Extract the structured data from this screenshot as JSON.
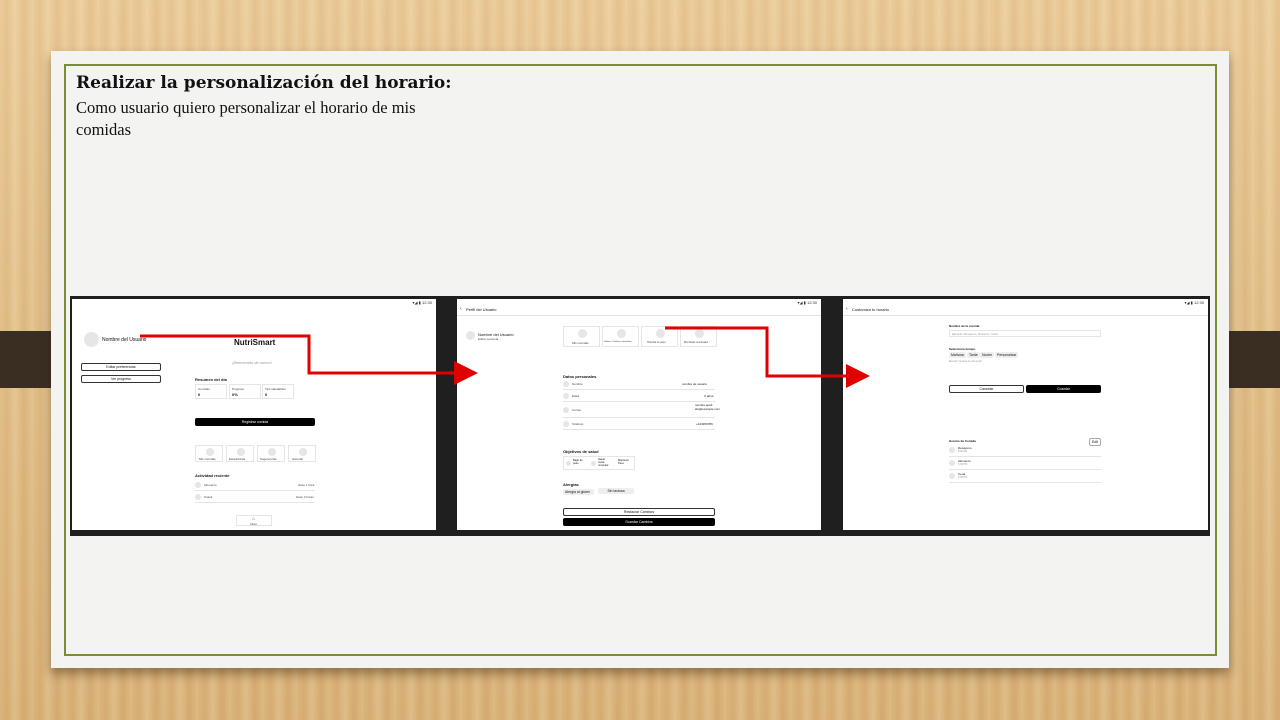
{
  "slide": {
    "title": "Realizar la personalización del horario:",
    "subtitle": "Como usuario quiero personalizar el horario de mis comidas"
  },
  "screen1": {
    "status": "▾◢ ▮ 12:30",
    "user_name": "Nombre del Usuario",
    "edit_prefs": "Editar preferencias",
    "progress": "Ver progreso",
    "app_name": "NutriSmart",
    "welcome": "¡Bienvenido de nuevo!",
    "summary_title": "Resumen del día",
    "stats": [
      {
        "label": "Comidas",
        "value": "0"
      },
      {
        "label": "Progreso",
        "value": "0%"
      },
      {
        "label": "Tips saludables",
        "value": "0"
      }
    ],
    "register_btn": "Registrar comida",
    "quick_actions": [
      "Mis comidas",
      "Estadísticas",
      "Sugerencias",
      "Historial"
    ],
    "activity_title": "Actividad reciente",
    "activity": [
      {
        "name": "Almuerzo",
        "time": "Hace 1 hora"
      },
      {
        "name": "Snack",
        "time": "Hace 3 horas"
      }
    ],
    "home_label": "Inicio"
  },
  "screen2": {
    "status": "▾◢ ▮ 12:30",
    "header": "Perfil del Usuario",
    "user_name": "Nombre del Usuario",
    "user_sub": "Editar personal",
    "tabs": [
      "Mis comidas",
      "Hábitos / Hábitos saludables",
      "Historial de peso",
      "Mis Metas semanales"
    ],
    "personal_title": "Datos personales",
    "fields": [
      {
        "label": "Nombre",
        "value": "nombre de usuario"
      },
      {
        "label": "Edad",
        "value": "X años"
      },
      {
        "label": "Correo",
        "value": "nombre.apell ido@example.com"
      },
      {
        "label": "Teléfono",
        "value": "+123456789"
      }
    ],
    "goals_title": "Objetivos de salud",
    "goals": [
      "Bajar de peso",
      "Ganar masa muscular",
      "Mantener Peso"
    ],
    "allergy_title": "Alergias",
    "allergies": [
      "Alergia al gluten",
      "Sin lactosa"
    ],
    "restore_btn": "Restaurar Cambios",
    "save_btn": "Guardar Cambios"
  },
  "screen3": {
    "status": "▾◢ ▮ 12:30",
    "header": "Customiza tu horario",
    "meal_name_label": "Nombre de la comida",
    "meal_name_placeholder": "Ejemplo: Desayuno, Almuerzo, Cena",
    "time_label": "Selecciona tiempo",
    "time_chips": [
      "Mañana",
      "Tarde",
      "Noche",
      "Personalizar"
    ],
    "time_hint": "Elección horaria de ello.ampli",
    "cancel_btn": "Cancelar",
    "save_btn": "Guardar",
    "schedule_title": "Horario de Comida",
    "edit_chip": "Edit",
    "meals": [
      {
        "name": "Desayuno",
        "time": "8:00 AM"
      },
      {
        "name": "Almuerzo",
        "time": "1:00 PM"
      },
      {
        "name": "Cena",
        "time": "8:00 PM"
      }
    ]
  },
  "colors": {
    "frame": "#7b8d34",
    "arrow": "#e00000",
    "band": "#3a2d22"
  }
}
